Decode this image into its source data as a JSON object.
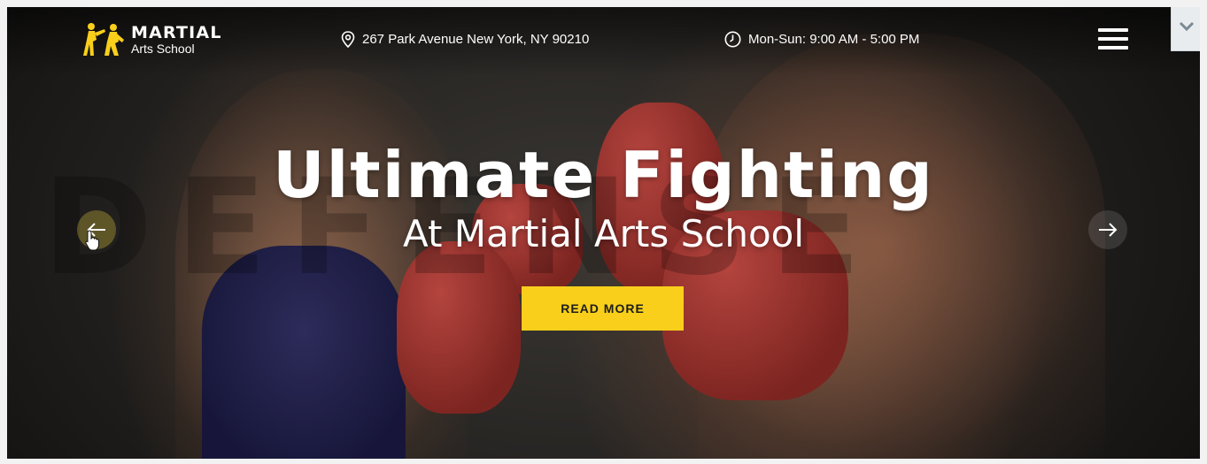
{
  "brand": {
    "name": "MARTIAL",
    "tagline": "Arts School",
    "accent_color": "#f9cf1b",
    "logo_icon": "martial-arts-fighters-icon"
  },
  "header": {
    "address": "267 Park Avenue New York, NY 90210",
    "address_icon": "location-pin-icon",
    "hours": "Mon-Sun: 9:00 AM - 5:00 PM",
    "hours_icon": "clock-icon",
    "menu_icon": "hamburger-menu-icon"
  },
  "hero": {
    "title": "Ultimate Fighting",
    "subtitle": "At Martial Arts School",
    "cta_label": "READ MORE",
    "background_word": "DEFENSE",
    "prev_icon": "arrow-left-icon",
    "next_icon": "arrow-right-icon"
  },
  "browser": {
    "scroll_toggle_icon": "chevron-down-icon"
  }
}
